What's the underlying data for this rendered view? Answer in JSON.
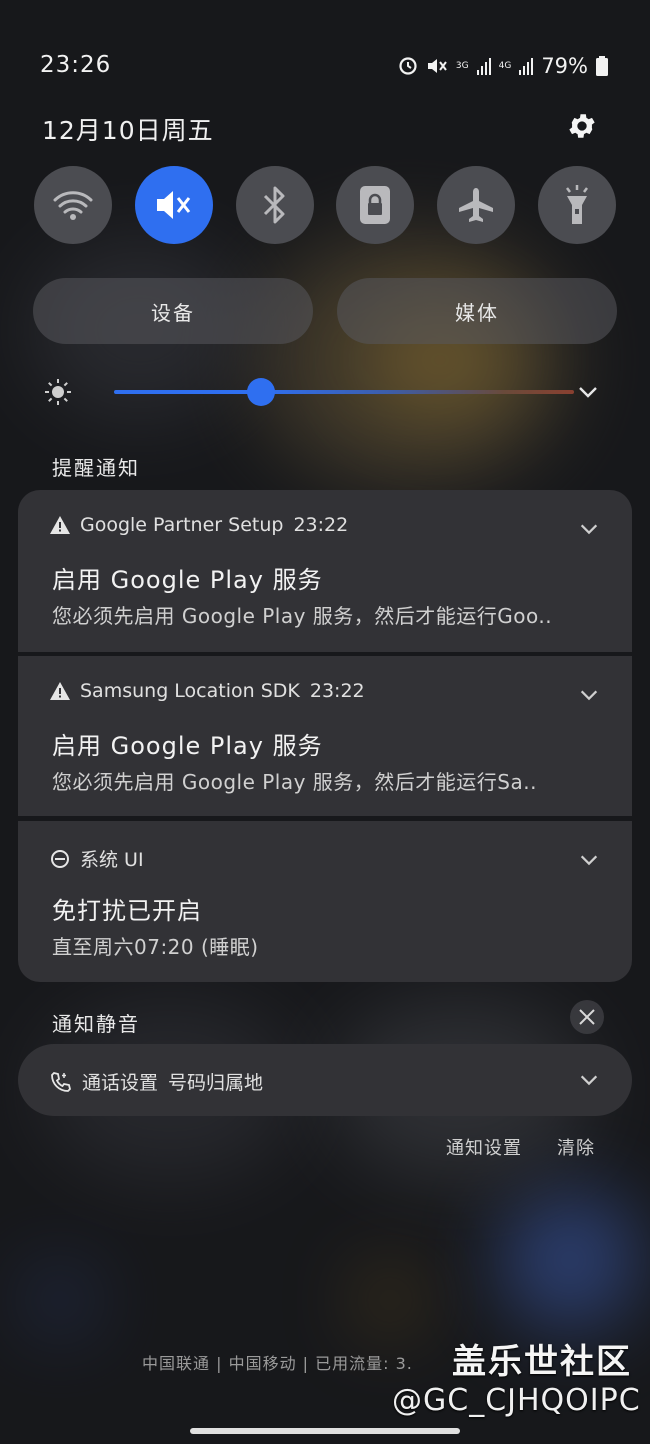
{
  "status_bar": {
    "time": "23:26",
    "battery": "79%",
    "net_top_1": "3G",
    "net_top_2": "4G"
  },
  "header": {
    "date": "12月10日周五"
  },
  "quick_settings": {
    "tiles": [
      {
        "icon": "wifi-icon",
        "active": false
      },
      {
        "icon": "mute-icon",
        "active": true
      },
      {
        "icon": "bluetooth-icon",
        "active": false
      },
      {
        "icon": "rotation-lock-icon",
        "active": false
      },
      {
        "icon": "airplane-icon",
        "active": false
      },
      {
        "icon": "flashlight-icon",
        "active": false
      }
    ],
    "devices_label": "设备",
    "media_label": "媒体",
    "brightness_level": 0.32
  },
  "alerts": {
    "section_title": "提醒通知",
    "items": [
      {
        "app": "Google Partner Setup",
        "time": "23:22",
        "title": "启用 Google Play 服务",
        "body": "您必须先启用 Google Play 服务，然后才能运行Goo.."
      },
      {
        "app": "Samsung Location SDK",
        "time": "23:22",
        "title": "启用 Google Play 服务",
        "body": "您必须先启用 Google Play 服务，然后才能运行Sa.."
      },
      {
        "app": "系统 UI",
        "time": "",
        "title": "免打扰已开启",
        "body": "直至周六07:20 (睡眠)"
      }
    ]
  },
  "silent": {
    "section_title": "通知静音",
    "item_app": "通话设置",
    "item_text": "号码归属地"
  },
  "actions": {
    "settings": "通知设置",
    "clear": "清除"
  },
  "footer": {
    "carrier": "中国联通 | 中国移动 | 已用流量: 3.",
    "watermark_title": "盖乐世社区",
    "watermark_user": "@GC_CJHQOIPC"
  },
  "colors": {
    "accent": "#2f6ff0",
    "card": "#323236",
    "tile": "#4b4c51"
  }
}
